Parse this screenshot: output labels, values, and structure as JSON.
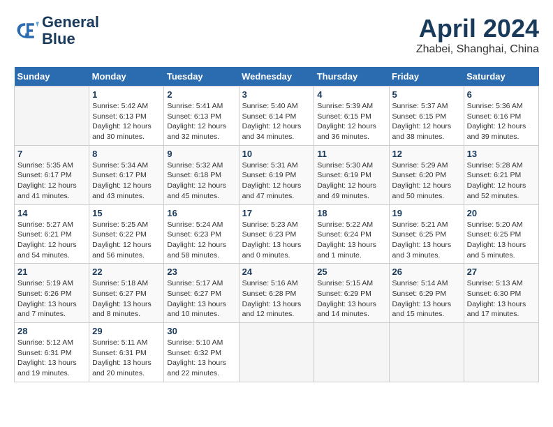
{
  "header": {
    "logo": {
      "line1": "General",
      "line2": "Blue"
    },
    "title": "April 2024",
    "subtitle": "Zhabei, Shanghai, China"
  },
  "calendar": {
    "days_of_week": [
      "Sunday",
      "Monday",
      "Tuesday",
      "Wednesday",
      "Thursday",
      "Friday",
      "Saturday"
    ],
    "weeks": [
      [
        {
          "day": "",
          "info": ""
        },
        {
          "day": "1",
          "info": "Sunrise: 5:42 AM\nSunset: 6:13 PM\nDaylight: 12 hours\nand 30 minutes."
        },
        {
          "day": "2",
          "info": "Sunrise: 5:41 AM\nSunset: 6:13 PM\nDaylight: 12 hours\nand 32 minutes."
        },
        {
          "day": "3",
          "info": "Sunrise: 5:40 AM\nSunset: 6:14 PM\nDaylight: 12 hours\nand 34 minutes."
        },
        {
          "day": "4",
          "info": "Sunrise: 5:39 AM\nSunset: 6:15 PM\nDaylight: 12 hours\nand 36 minutes."
        },
        {
          "day": "5",
          "info": "Sunrise: 5:37 AM\nSunset: 6:15 PM\nDaylight: 12 hours\nand 38 minutes."
        },
        {
          "day": "6",
          "info": "Sunrise: 5:36 AM\nSunset: 6:16 PM\nDaylight: 12 hours\nand 39 minutes."
        }
      ],
      [
        {
          "day": "7",
          "info": "Sunrise: 5:35 AM\nSunset: 6:17 PM\nDaylight: 12 hours\nand 41 minutes."
        },
        {
          "day": "8",
          "info": "Sunrise: 5:34 AM\nSunset: 6:17 PM\nDaylight: 12 hours\nand 43 minutes."
        },
        {
          "day": "9",
          "info": "Sunrise: 5:32 AM\nSunset: 6:18 PM\nDaylight: 12 hours\nand 45 minutes."
        },
        {
          "day": "10",
          "info": "Sunrise: 5:31 AM\nSunset: 6:19 PM\nDaylight: 12 hours\nand 47 minutes."
        },
        {
          "day": "11",
          "info": "Sunrise: 5:30 AM\nSunset: 6:19 PM\nDaylight: 12 hours\nand 49 minutes."
        },
        {
          "day": "12",
          "info": "Sunrise: 5:29 AM\nSunset: 6:20 PM\nDaylight: 12 hours\nand 50 minutes."
        },
        {
          "day": "13",
          "info": "Sunrise: 5:28 AM\nSunset: 6:21 PM\nDaylight: 12 hours\nand 52 minutes."
        }
      ],
      [
        {
          "day": "14",
          "info": "Sunrise: 5:27 AM\nSunset: 6:21 PM\nDaylight: 12 hours\nand 54 minutes."
        },
        {
          "day": "15",
          "info": "Sunrise: 5:25 AM\nSunset: 6:22 PM\nDaylight: 12 hours\nand 56 minutes."
        },
        {
          "day": "16",
          "info": "Sunrise: 5:24 AM\nSunset: 6:23 PM\nDaylight: 12 hours\nand 58 minutes."
        },
        {
          "day": "17",
          "info": "Sunrise: 5:23 AM\nSunset: 6:23 PM\nDaylight: 13 hours\nand 0 minutes."
        },
        {
          "day": "18",
          "info": "Sunrise: 5:22 AM\nSunset: 6:24 PM\nDaylight: 13 hours\nand 1 minute."
        },
        {
          "day": "19",
          "info": "Sunrise: 5:21 AM\nSunset: 6:25 PM\nDaylight: 13 hours\nand 3 minutes."
        },
        {
          "day": "20",
          "info": "Sunrise: 5:20 AM\nSunset: 6:25 PM\nDaylight: 13 hours\nand 5 minutes."
        }
      ],
      [
        {
          "day": "21",
          "info": "Sunrise: 5:19 AM\nSunset: 6:26 PM\nDaylight: 13 hours\nand 7 minutes."
        },
        {
          "day": "22",
          "info": "Sunrise: 5:18 AM\nSunset: 6:27 PM\nDaylight: 13 hours\nand 8 minutes."
        },
        {
          "day": "23",
          "info": "Sunrise: 5:17 AM\nSunset: 6:27 PM\nDaylight: 13 hours\nand 10 minutes."
        },
        {
          "day": "24",
          "info": "Sunrise: 5:16 AM\nSunset: 6:28 PM\nDaylight: 13 hours\nand 12 minutes."
        },
        {
          "day": "25",
          "info": "Sunrise: 5:15 AM\nSunset: 6:29 PM\nDaylight: 13 hours\nand 14 minutes."
        },
        {
          "day": "26",
          "info": "Sunrise: 5:14 AM\nSunset: 6:29 PM\nDaylight: 13 hours\nand 15 minutes."
        },
        {
          "day": "27",
          "info": "Sunrise: 5:13 AM\nSunset: 6:30 PM\nDaylight: 13 hours\nand 17 minutes."
        }
      ],
      [
        {
          "day": "28",
          "info": "Sunrise: 5:12 AM\nSunset: 6:31 PM\nDaylight: 13 hours\nand 19 minutes."
        },
        {
          "day": "29",
          "info": "Sunrise: 5:11 AM\nSunset: 6:31 PM\nDaylight: 13 hours\nand 20 minutes."
        },
        {
          "day": "30",
          "info": "Sunrise: 5:10 AM\nSunset: 6:32 PM\nDaylight: 13 hours\nand 22 minutes."
        },
        {
          "day": "",
          "info": ""
        },
        {
          "day": "",
          "info": ""
        },
        {
          "day": "",
          "info": ""
        },
        {
          "day": "",
          "info": ""
        }
      ]
    ]
  }
}
